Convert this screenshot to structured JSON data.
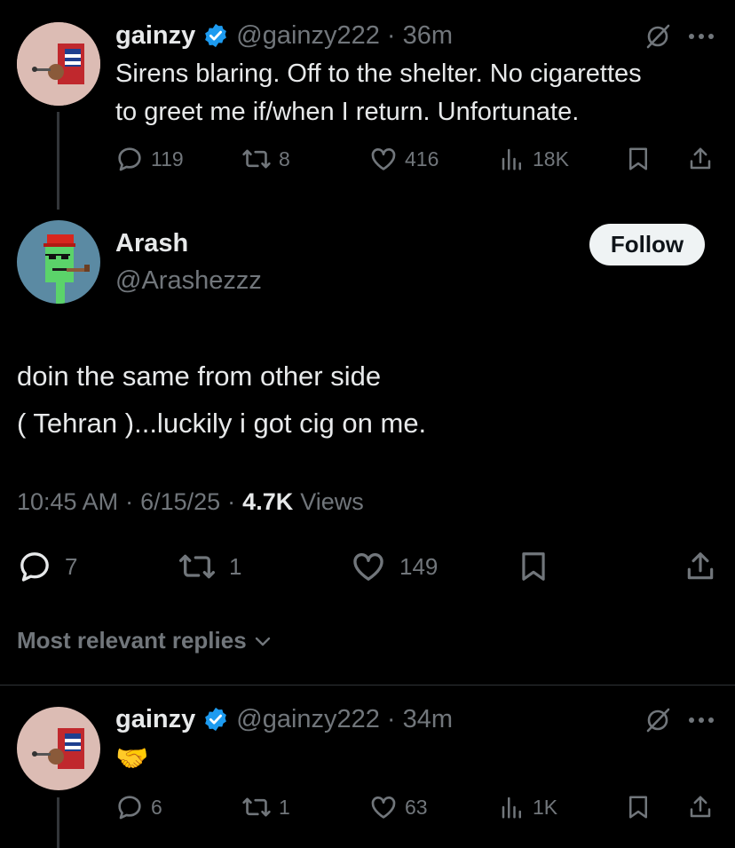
{
  "tweet1": {
    "name": "gainzy",
    "handle": "@gainzy222",
    "sep": "·",
    "time": "36m",
    "text_line1": "Sirens blaring. Off to the shelter. No cigarettes",
    "text_line2": "to greet me if/when I return. Unfortunate.",
    "replies": "119",
    "retweets": "8",
    "likes": "416",
    "views": "18K"
  },
  "main": {
    "name": "Arash",
    "handle": "@Arashezzz",
    "follow_label": "Follow",
    "text_line1": "doin the same from other side",
    "text_line2": "( Tehran )...luckily i got cig on me.",
    "time": "10:45 AM",
    "sep": "·",
    "date": "6/15/25",
    "views_count": "4.7K",
    "views_label": "Views",
    "replies": "7",
    "retweets": "1",
    "likes": "149"
  },
  "sort": {
    "label": "Most relevant replies"
  },
  "reply1": {
    "name": "gainzy",
    "handle": "@gainzy222",
    "sep": "·",
    "time": "34m",
    "emoji": "🤝",
    "replies": "6",
    "retweets": "1",
    "likes": "63",
    "views": "1K"
  },
  "colors": {
    "background": "#000000",
    "text": "#e7e9ea",
    "muted": "#71767b",
    "verified": "#1d9bf0",
    "follow_bg": "#eff3f4"
  },
  "icons": [
    "verified-badge-icon",
    "grok-icon",
    "more-icon",
    "reply-icon",
    "retweet-icon",
    "like-icon",
    "views-icon",
    "bookmark-icon",
    "share-icon",
    "chevron-down-icon"
  ]
}
